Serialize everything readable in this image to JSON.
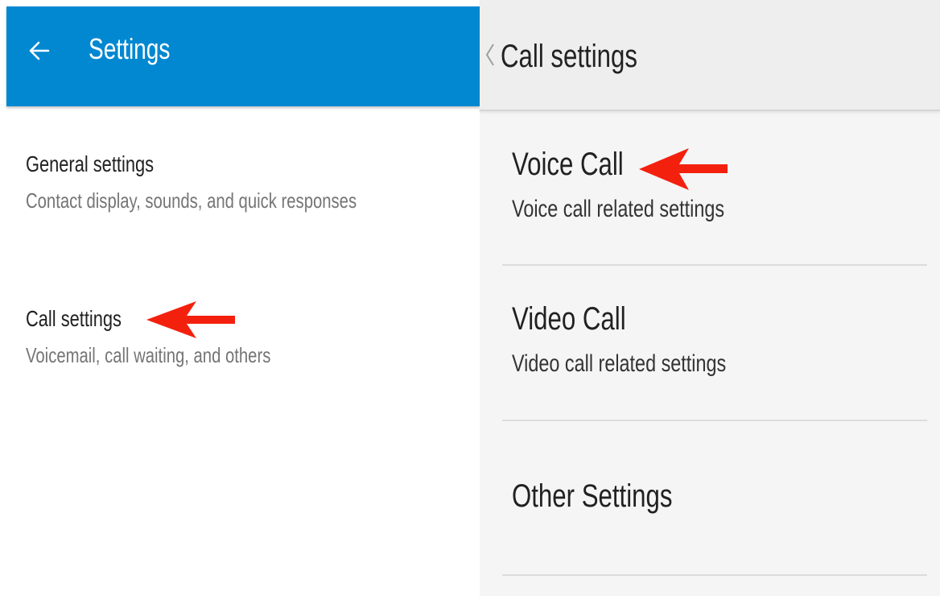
{
  "left": {
    "header": {
      "title": "Settings",
      "back_icon": "arrow-left-icon",
      "color": "#0288d1"
    },
    "items": [
      {
        "title": "General settings",
        "subtitle": "Contact display, sounds, and quick responses"
      },
      {
        "title": "Call settings",
        "subtitle": "Voicemail, call waiting, and others"
      }
    ]
  },
  "right": {
    "header": {
      "title": "Call settings",
      "back_icon": "chevron-left-icon"
    },
    "items": [
      {
        "title": "Voice Call",
        "subtitle": "Voice call related settings"
      },
      {
        "title": "Video Call",
        "subtitle": "Video call related settings"
      },
      {
        "title": "Other Settings"
      }
    ]
  },
  "annotations": {
    "arrow_color": "#f4200e",
    "arrow_icon": "red-pointer-arrow-icon"
  }
}
